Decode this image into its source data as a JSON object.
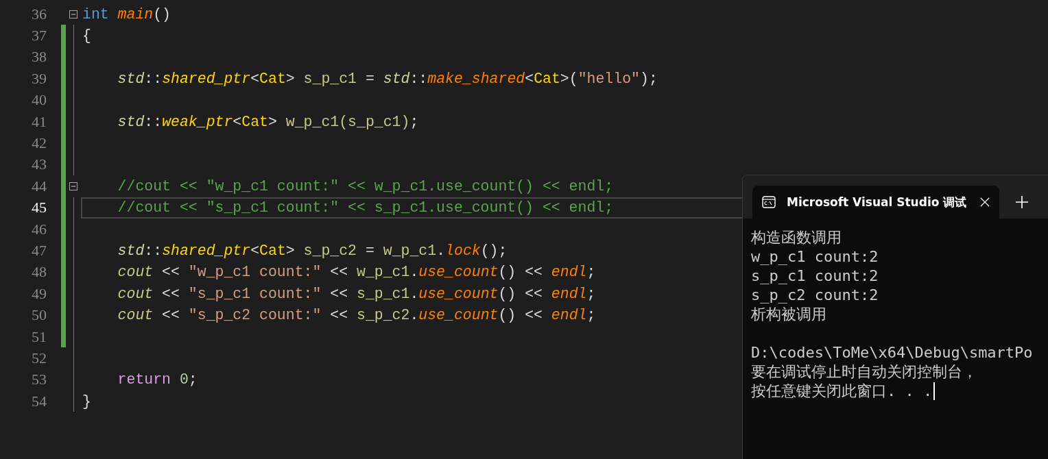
{
  "editor": {
    "lines": [
      {
        "number": "36",
        "fold": true,
        "changed": false,
        "current": false,
        "tokens": [
          {
            "kind": "keyword",
            "text": "int "
          },
          {
            "kind": "func",
            "text": "main"
          },
          {
            "kind": "plain",
            "text": "()"
          }
        ]
      },
      {
        "number": "37",
        "fold": false,
        "changed": true,
        "current": false,
        "tokens": [
          {
            "kind": "plain",
            "text": "{"
          }
        ]
      },
      {
        "number": "38",
        "fold": false,
        "changed": true,
        "current": false
      },
      {
        "number": "39",
        "fold": false,
        "changed": true,
        "current": false,
        "tokens": [
          {
            "kind": "ns",
            "text": "    std"
          },
          {
            "kind": "plain",
            "text": "::"
          },
          {
            "kind": "type",
            "text": "shared_ptr"
          },
          {
            "kind": "plain",
            "text": "<"
          },
          {
            "kind": "class",
            "text": "Cat"
          },
          {
            "kind": "plain",
            "text": "> "
          },
          {
            "kind": "var",
            "text": "s_p_c1"
          },
          {
            "kind": "plain",
            "text": " = "
          },
          {
            "kind": "ns",
            "text": "std"
          },
          {
            "kind": "plain",
            "text": "::"
          },
          {
            "kind": "func",
            "text": "make_shared"
          },
          {
            "kind": "plain",
            "text": "<"
          },
          {
            "kind": "class",
            "text": "Cat"
          },
          {
            "kind": "plain",
            "text": ">("
          },
          {
            "kind": "string",
            "text": "\"hello\""
          },
          {
            "kind": "plain",
            "text": ");"
          }
        ]
      },
      {
        "number": "40",
        "fold": false,
        "changed": true,
        "current": false
      },
      {
        "number": "41",
        "fold": false,
        "changed": true,
        "current": false,
        "tokens": [
          {
            "kind": "ns",
            "text": "    std"
          },
          {
            "kind": "plain",
            "text": "::"
          },
          {
            "kind": "type",
            "text": "weak_ptr"
          },
          {
            "kind": "plain",
            "text": "<"
          },
          {
            "kind": "class",
            "text": "Cat"
          },
          {
            "kind": "plain",
            "text": "> "
          },
          {
            "kind": "var",
            "text": "w_p_c1(s_p_c1)"
          },
          {
            "kind": "plain",
            "text": ";"
          }
        ]
      },
      {
        "number": "42",
        "fold": false,
        "changed": true,
        "current": false
      },
      {
        "number": "43",
        "fold": false,
        "changed": true,
        "current": false
      },
      {
        "number": "44",
        "fold": true,
        "changed": true,
        "current": false,
        "tokens": [
          {
            "kind": "comment",
            "text": "    //cout << \"w_p_c1 count:\" << w_p_c1.use_count() << endl;"
          }
        ]
      },
      {
        "number": "45",
        "fold": false,
        "changed": true,
        "current": true,
        "tokens": [
          {
            "kind": "comment",
            "text": "    //cout << \"s_p_c1 count:\" << s_p_c1.use_count() << endl;"
          }
        ]
      },
      {
        "number": "46",
        "fold": false,
        "changed": true,
        "current": false
      },
      {
        "number": "47",
        "fold": false,
        "changed": true,
        "current": false,
        "tokens": [
          {
            "kind": "ns",
            "text": "    std"
          },
          {
            "kind": "plain",
            "text": "::"
          },
          {
            "kind": "type",
            "text": "shared_ptr"
          },
          {
            "kind": "plain",
            "text": "<"
          },
          {
            "kind": "class",
            "text": "Cat"
          },
          {
            "kind": "plain",
            "text": "> "
          },
          {
            "kind": "var",
            "text": "s_p_c2"
          },
          {
            "kind": "plain",
            "text": " = "
          },
          {
            "kind": "var",
            "text": "w_p_c1"
          },
          {
            "kind": "plain",
            "text": "."
          },
          {
            "kind": "func",
            "text": "lock"
          },
          {
            "kind": "plain",
            "text": "();"
          }
        ]
      },
      {
        "number": "48",
        "fold": false,
        "changed": true,
        "current": false,
        "tokens": [
          {
            "kind": "stream",
            "text": "    cout"
          },
          {
            "kind": "plain",
            "text": " << "
          },
          {
            "kind": "string",
            "text": "\"w_p_c1 count:\""
          },
          {
            "kind": "plain",
            "text": " << "
          },
          {
            "kind": "var",
            "text": "w_p_c1"
          },
          {
            "kind": "plain",
            "text": "."
          },
          {
            "kind": "func",
            "text": "use_count"
          },
          {
            "kind": "plain",
            "text": "() << "
          },
          {
            "kind": "func",
            "text": "endl"
          },
          {
            "kind": "plain",
            "text": ";"
          }
        ]
      },
      {
        "number": "49",
        "fold": false,
        "changed": true,
        "current": false,
        "tokens": [
          {
            "kind": "stream",
            "text": "    cout"
          },
          {
            "kind": "plain",
            "text": " << "
          },
          {
            "kind": "string",
            "text": "\"s_p_c1 count:\""
          },
          {
            "kind": "plain",
            "text": " << "
          },
          {
            "kind": "var",
            "text": "s_p_c1"
          },
          {
            "kind": "plain",
            "text": "."
          },
          {
            "kind": "func",
            "text": "use_count"
          },
          {
            "kind": "plain",
            "text": "() << "
          },
          {
            "kind": "func",
            "text": "endl"
          },
          {
            "kind": "plain",
            "text": ";"
          }
        ]
      },
      {
        "number": "50",
        "fold": false,
        "changed": true,
        "current": false,
        "tokens": [
          {
            "kind": "stream",
            "text": "    cout"
          },
          {
            "kind": "plain",
            "text": " << "
          },
          {
            "kind": "string",
            "text": "\"s_p_c2 count:\""
          },
          {
            "kind": "plain",
            "text": " << "
          },
          {
            "kind": "var",
            "text": "s_p_c2"
          },
          {
            "kind": "plain",
            "text": "."
          },
          {
            "kind": "func",
            "text": "use_count"
          },
          {
            "kind": "plain",
            "text": "() << "
          },
          {
            "kind": "func",
            "text": "endl"
          },
          {
            "kind": "plain",
            "text": ";"
          }
        ]
      },
      {
        "number": "51",
        "fold": false,
        "changed": true,
        "current": false
      },
      {
        "number": "52",
        "fold": false,
        "changed": false,
        "current": false
      },
      {
        "number": "53",
        "fold": false,
        "changed": false,
        "current": false,
        "tokens": [
          {
            "kind": "control",
            "text": "    return "
          },
          {
            "kind": "number",
            "text": "0"
          },
          {
            "kind": "plain",
            "text": ";"
          }
        ]
      },
      {
        "number": "54",
        "fold": false,
        "changed": false,
        "current": false,
        "tokens": [
          {
            "kind": "plain",
            "text": "}"
          }
        ]
      }
    ]
  },
  "console": {
    "tab_title": "Microsoft Visual Studio 调试",
    "output_blocks": [
      [
        "构造函数调用",
        "w_p_c1 count:2",
        "s_p_c1 count:2",
        "s_p_c2 count:2",
        "析构被调用"
      ],
      [
        "D:\\codes\\ToMe\\x64\\Debug\\smartPo",
        "要在调试停止时自动关闭控制台，",
        "按任意键关闭此窗口. . ."
      ]
    ]
  }
}
